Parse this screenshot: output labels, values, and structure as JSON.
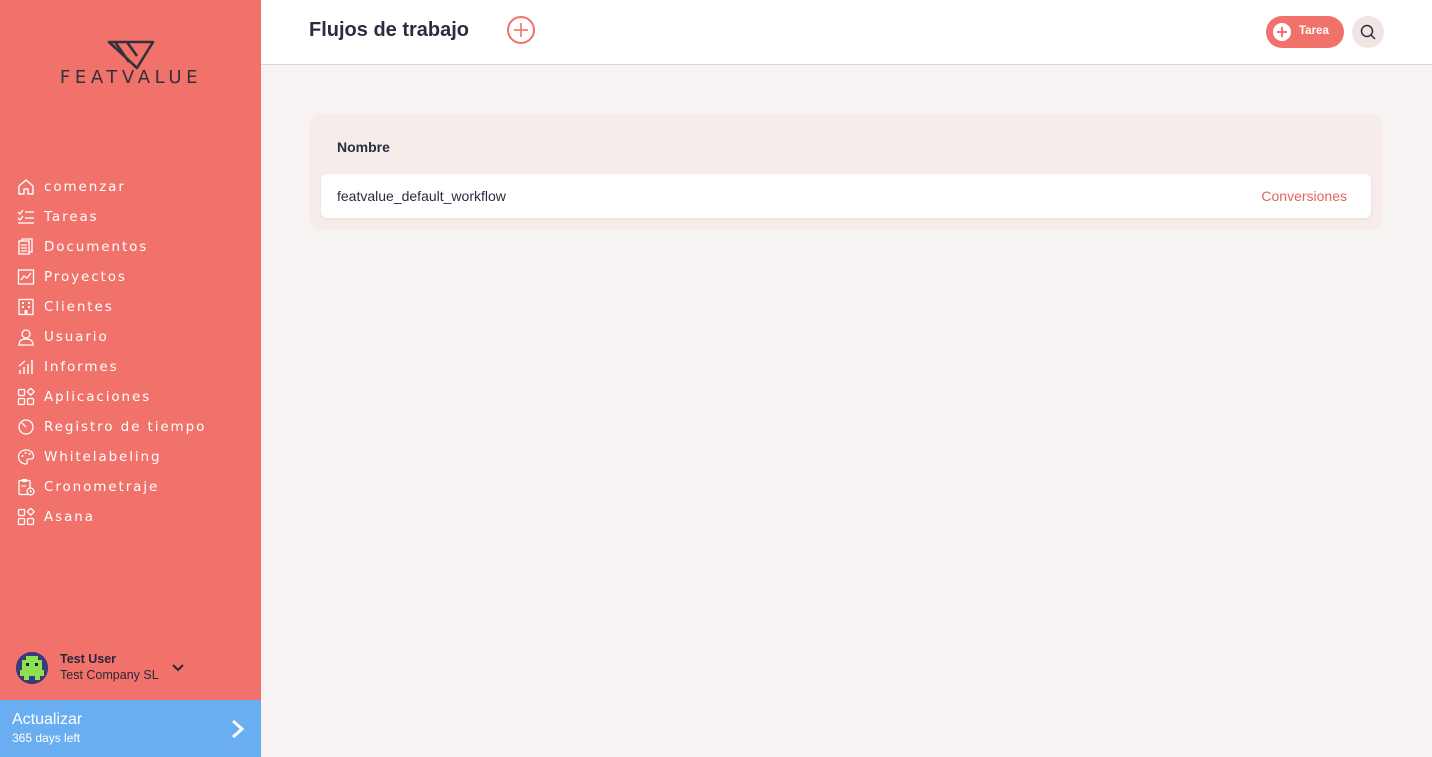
{
  "brand": {
    "name": "FEATVALUE",
    "accent": "#f1726b",
    "sidebar_bg": "#f1726b",
    "upgrade_bg": "#6aaef2"
  },
  "sidebar": {
    "items": [
      {
        "label": "comenzar",
        "icon": "home-icon"
      },
      {
        "label": "Tareas",
        "icon": "checklist-icon"
      },
      {
        "label": "Documentos",
        "icon": "document-icon"
      },
      {
        "label": "Proyectos",
        "icon": "chart-board-icon"
      },
      {
        "label": "Clientes",
        "icon": "building-icon"
      },
      {
        "label": "Usuario",
        "icon": "user-icon"
      },
      {
        "label": "Informes",
        "icon": "signal-bars-icon"
      },
      {
        "label": "Aplicaciones",
        "icon": "apps-icon"
      },
      {
        "label": "Registro de tiempo",
        "icon": "timer-icon"
      },
      {
        "label": "Whitelabeling",
        "icon": "palette-icon"
      },
      {
        "label": "Cronometraje",
        "icon": "clipboard-clock-icon"
      },
      {
        "label": "Asana",
        "icon": "apps-icon"
      }
    ],
    "user": {
      "name": "Test User",
      "company": "Test Company SL"
    },
    "upgrade": {
      "title": "Actualizar",
      "subtitle": "365 days left"
    }
  },
  "header": {
    "title": "Flujos de trabajo",
    "task_button_label": "Tarea"
  },
  "workflows": {
    "column_header": "Nombre",
    "rows": [
      {
        "name": "featvalue_default_workflow",
        "link": "Conversiones"
      }
    ]
  }
}
